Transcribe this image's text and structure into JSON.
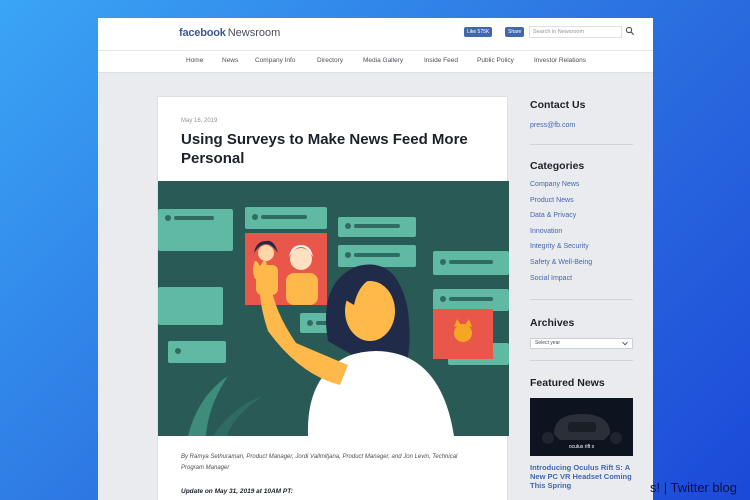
{
  "header": {
    "brand_bold": "facebook",
    "brand_rest": "Newsroom",
    "like_label": "Like 575K",
    "share_label": "Share",
    "search_placeholder": "Search in Newsroom"
  },
  "nav": {
    "items": [
      {
        "label": "Home"
      },
      {
        "label": "News"
      },
      {
        "label": "Company Info"
      },
      {
        "label": "Directory"
      },
      {
        "label": "Media Gallery"
      },
      {
        "label": "Inside Feed"
      },
      {
        "label": "Public Policy"
      },
      {
        "label": "Investor Relations"
      }
    ]
  },
  "article": {
    "date": "May 16, 2019",
    "title": "Using Surveys to Make News Feed More Personal",
    "byline": "By Ramya Sethuraman, Product Manager, Jordi Vallmitjana, Product Manager, and Jon Levin, Technical Program Manager",
    "update": "Update on May 31, 2019 at 10AM PT:"
  },
  "sidebar": {
    "contact_heading": "Contact Us",
    "contact_email": "press@fb.com",
    "categories_heading": "Categories",
    "categories": [
      {
        "label": "Company News"
      },
      {
        "label": "Product News"
      },
      {
        "label": "Data & Privacy"
      },
      {
        "label": "Innovation"
      },
      {
        "label": "Integrity & Security"
      },
      {
        "label": "Safety & Well-Being"
      },
      {
        "label": "Social Impact"
      }
    ],
    "archives_heading": "Archives",
    "archives_select": "Select year",
    "featured_heading": "Featured News",
    "featured_title": "Introducing Oculus Rift S: A New PC VR Headset Coming This Spring",
    "featured_image_text": "oculus rift s"
  },
  "overlay": {
    "caption": "s! | Twitter blog"
  },
  "colors": {
    "facebook_blue": "#3b5998",
    "link_blue": "#4267b2",
    "hero_bg": "#2a5a55"
  }
}
